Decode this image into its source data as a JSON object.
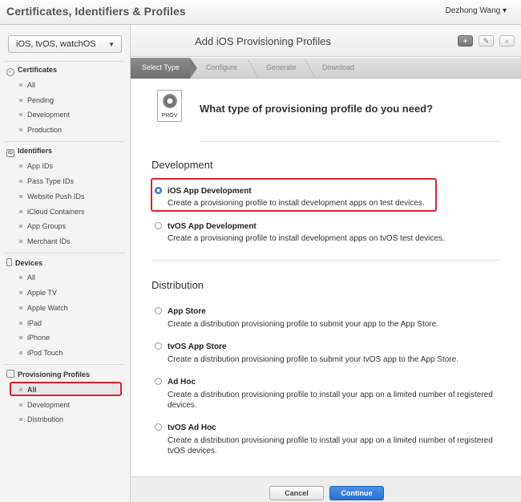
{
  "topbar": {
    "title": "Certificates, Identifiers & Profiles",
    "user": "Dezhong Wang ▾"
  },
  "sidebar": {
    "platform_select": "iOS, tvOS, watchOS",
    "sections": [
      {
        "title": "Certificates",
        "items": [
          "All",
          "Pending",
          "Development",
          "Production"
        ]
      },
      {
        "title": "Identifiers",
        "items": [
          "App IDs",
          "Pass Type IDs",
          "Website Push IDs",
          "iCloud Containers",
          "App Groups",
          "Merchant IDs"
        ]
      },
      {
        "title": "Devices",
        "items": [
          "All",
          "Apple TV",
          "Apple Watch",
          "iPad",
          "iPhone",
          "iPod Touch"
        ]
      },
      {
        "title": "Provisioning Profiles",
        "items": [
          "All",
          "Development",
          "Distribution"
        ]
      }
    ],
    "selected": "Provisioning Profiles > All"
  },
  "header": {
    "title": "Add iOS Provisioning Profiles"
  },
  "steps": [
    "Select Type",
    "Configure",
    "Generate",
    "Download"
  ],
  "content": {
    "icon_label": "PROV",
    "question": "What type of provisioning profile do you need?",
    "groups": [
      {
        "title": "Development",
        "options": [
          {
            "title": "iOS App Development",
            "desc": "Create a provisioning profile to install development apps on test devices.",
            "checked": true
          },
          {
            "title": "tvOS App Development",
            "desc": "Create a provisioning profile to install development apps on tvOS test devices.",
            "checked": false
          }
        ]
      },
      {
        "title": "Distribution",
        "options": [
          {
            "title": "App Store",
            "desc": "Create a distribution provisioning profile to submit your app to the App Store.",
            "checked": false
          },
          {
            "title": "tvOS App Store",
            "desc": "Create a distribution provisioning profile to submit your tvOS app to the App Store.",
            "checked": false
          },
          {
            "title": "Ad Hoc",
            "desc": "Create a distribution provisioning profile to install your app on a limited number of registered devices.",
            "checked": false
          },
          {
            "title": "tvOS Ad Hoc",
            "desc": "Create a distribution provisioning profile to install your app on a limited number of registered tvOS devices.",
            "checked": false
          }
        ]
      }
    ]
  },
  "footer": {
    "cancel_label": "Cancel",
    "continue_label": "Continue"
  },
  "colors": {
    "highlight": "#d9232f",
    "primary": "#2a6fd1"
  }
}
